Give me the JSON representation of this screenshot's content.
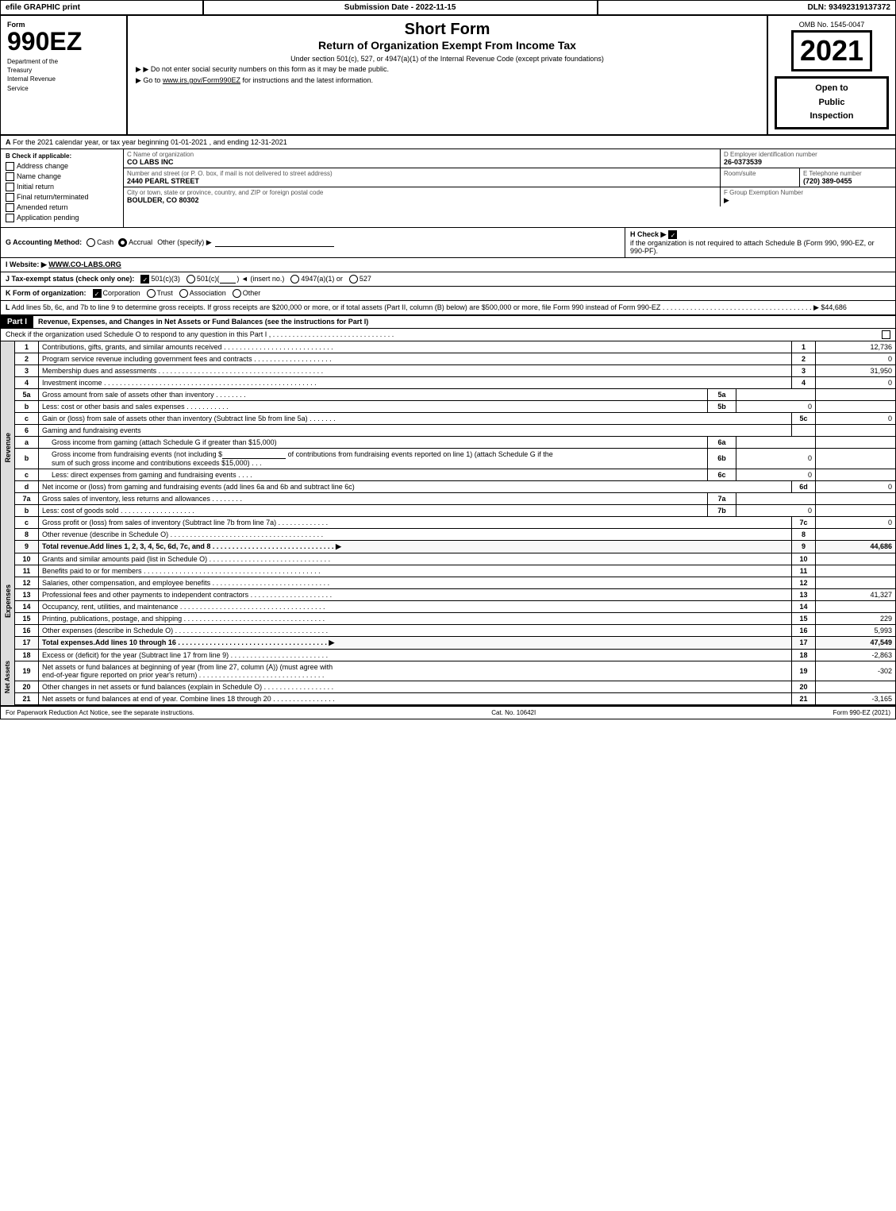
{
  "topbar": {
    "left": "efile GRAPHIC print",
    "mid": "Submission Date - 2022-11-15",
    "right": "DLN: 93492319137372"
  },
  "header": {
    "form_number": "990EZ",
    "dept_line1": "Department of the",
    "dept_line2": "Treasury",
    "dept_line3": "Internal Revenue",
    "dept_line4": "Service",
    "title1": "Short Form",
    "title2": "Return of Organization Exempt From Income Tax",
    "subtitle": "Under section 501(c), 527, or 4947(a)(1) of the Internal Revenue Code (except private foundations)",
    "note1": "▶ Do not enter social security numbers on this form as it may be made public.",
    "note2": "▶ Go to www.irs.gov/Form990EZ for instructions and the latest information.",
    "omb": "OMB No. 1545-0047",
    "year": "2021",
    "open_public": "Open to\nPublic\nInspection"
  },
  "section_a": {
    "label": "A",
    "text": "For the 2021 calendar year, or tax year beginning 01-01-2021 , and ending 12-31-2021"
  },
  "check_applicable": {
    "label": "B Check if applicable:",
    "items": [
      {
        "id": "address_change",
        "label": "Address change",
        "checked": false
      },
      {
        "id": "name_change",
        "label": "Name change",
        "checked": false
      },
      {
        "id": "initial_return",
        "label": "Initial return",
        "checked": false
      },
      {
        "id": "final_return",
        "label": "Final return/terminated",
        "checked": false
      },
      {
        "id": "amended_return",
        "label": "Amended return",
        "checked": false
      },
      {
        "id": "application_pending",
        "label": "Application pending",
        "checked": false
      }
    ]
  },
  "org_info": {
    "c_label": "C Name of organization",
    "c_value": "CO LABS INC",
    "d_label": "D Employer identification number",
    "d_value": "26-0373539",
    "street_label": "Number and street (or P. O. box, if mail is not delivered to street address)",
    "street_value": "2440 PEARL STREET",
    "room_label": "Room/suite",
    "room_value": "",
    "e_label": "E Telephone number",
    "e_value": "(720) 389-0455",
    "city_label": "City or town, state or province, country, and ZIP or foreign postal code",
    "city_value": "BOULDER, CO  80302",
    "f_label": "F Group Exemption Number",
    "f_value": "▶"
  },
  "accounting": {
    "label": "G Accounting Method:",
    "cash_label": "Cash",
    "accrual_label": "Accrual",
    "accrual_checked": true,
    "other_label": "Other (specify) ▶"
  },
  "h_check": {
    "label": "H Check ▶",
    "checked": true,
    "text": "if the organization is not required to attach Schedule B (Form 990, 990-EZ, or 990-PF)."
  },
  "website": {
    "label": "I Website: ▶",
    "value": "WWW.CO-LABS.ORG"
  },
  "tax_status": {
    "label": "J Tax-exempt status (check only one):",
    "options": [
      {
        "id": "501c3",
        "label": "501(c)(3)",
        "checked": true
      },
      {
        "id": "501c",
        "label": "501(c)(",
        "checked": false,
        "note": ") ◄ (insert no.)"
      },
      {
        "id": "4947a1",
        "label": "4947(a)(1) or",
        "checked": false
      },
      {
        "id": "527",
        "label": "527",
        "checked": false
      }
    ]
  },
  "form_org": {
    "label": "K Form of organization:",
    "options": [
      {
        "id": "corp",
        "label": "Corporation",
        "checked": true
      },
      {
        "id": "trust",
        "label": "Trust",
        "checked": false
      },
      {
        "id": "assoc",
        "label": "Association",
        "checked": false
      },
      {
        "id": "other",
        "label": "Other",
        "checked": false
      }
    ]
  },
  "l_text": "L Add lines 5b, 6c, and 7b to line 9 to determine gross receipts. If gross receipts are $200,000 or more, or if total assets (Part II, column (B) below) are $500,000 or more, file Form 990 instead of Form 990-EZ . . . . . . . . . . . . . . . . . . . . . . . . . . . . . . . . . . . . . . ▶ $44,686",
  "part1": {
    "header": "Part I",
    "title": "Revenue, Expenses, and Changes in Net Assets or Fund Balances (see the instructions for Part I)",
    "check_note": "Check if the organization used Schedule O to respond to any question in this Part I , . . . . . . . . . . . . . . . . . . . . . . . . . . . . . . .",
    "rows": [
      {
        "num": "1",
        "desc": "Contributions, gifts, grants, and similar amounts received",
        "dots": true,
        "line_num": "1",
        "value": "12,736",
        "indent": false
      },
      {
        "num": "2",
        "desc": "Program service revenue including government fees and contracts",
        "dots": true,
        "line_num": "2",
        "value": "0",
        "indent": false
      },
      {
        "num": "3",
        "desc": "Membership dues and assessments",
        "dots": true,
        "line_num": "3",
        "value": "31,950",
        "indent": false
      },
      {
        "num": "4",
        "desc": "Investment income",
        "dots": true,
        "line_num": "4",
        "value": "0",
        "indent": false
      },
      {
        "num": "5a",
        "desc": "Gross amount from sale of assets other than inventory",
        "dots": false,
        "box_label": "5a",
        "box_val": "",
        "line_num": "",
        "value": "",
        "indent": false
      },
      {
        "num": "5b",
        "desc": "Less: cost or other basis and sales expenses",
        "dots": false,
        "box_label": "5b",
        "box_val": "0",
        "line_num": "",
        "value": "",
        "indent": false
      },
      {
        "num": "5c",
        "desc": "Gain or (loss) from sale of assets other than inventory (Subtract line 5b from line 5a)",
        "dots": true,
        "line_num": "5c",
        "value": "0",
        "indent": false
      },
      {
        "num": "6",
        "desc": "Gaming and fundraising events",
        "dots": false,
        "line_num": "",
        "value": "",
        "indent": false
      },
      {
        "num": "6a",
        "desc": "Gross income from gaming (attach Schedule G if greater than $15,000)",
        "dots": false,
        "box_label": "6a",
        "box_val": "",
        "line_num": "",
        "value": "",
        "indent": true
      },
      {
        "num": "6b_text",
        "desc": "Gross income from fundraising events (not including $_____ of contributions from fundraising events reported on line 1) (attach Schedule G if the sum of such gross income and contributions exceeds $15,000)",
        "dots": false,
        "box_label": "6b",
        "box_val": "0",
        "line_num": "",
        "value": "",
        "indent": true
      },
      {
        "num": "6c",
        "desc": "Less: direct expenses from gaming and fundraising events",
        "dots": false,
        "box_label": "6c",
        "box_val": "0",
        "line_num": "",
        "value": "",
        "indent": true
      },
      {
        "num": "6d",
        "desc": "Net income or (loss) from gaming and fundraising events (add lines 6a and 6b and subtract line 6c)",
        "dots": false,
        "line_num": "6d",
        "value": "0",
        "indent": false
      },
      {
        "num": "7a",
        "desc": "Gross sales of inventory, less returns and allowances",
        "dots": true,
        "box_label": "7a",
        "box_val": "",
        "line_num": "",
        "value": "",
        "indent": false
      },
      {
        "num": "7b",
        "desc": "Less: cost of goods sold",
        "dots": true,
        "box_label": "7b",
        "box_val": "0",
        "line_num": "",
        "value": "",
        "indent": false
      },
      {
        "num": "7c",
        "desc": "Gross profit or (loss) from sales of inventory (Subtract line 7b from line 7a)",
        "dots": true,
        "line_num": "7c",
        "value": "0",
        "indent": false
      },
      {
        "num": "8",
        "desc": "Other revenue (describe in Schedule O)",
        "dots": true,
        "line_num": "8",
        "value": "",
        "indent": false
      },
      {
        "num": "9",
        "desc": "Total revenue. Add lines 1, 2, 3, 4, 5c, 6d, 7c, and 8",
        "dots": true,
        "arrow": true,
        "line_num": "9",
        "value": "44,686",
        "indent": false,
        "bold": true
      }
    ]
  },
  "expenses": {
    "rows": [
      {
        "num": "10",
        "desc": "Grants and similar amounts paid (list in Schedule O)",
        "dots": true,
        "line_num": "10",
        "value": ""
      },
      {
        "num": "11",
        "desc": "Benefits paid to or for members",
        "dots": true,
        "line_num": "11",
        "value": ""
      },
      {
        "num": "12",
        "desc": "Salaries, other compensation, and employee benefits",
        "dots": true,
        "line_num": "12",
        "value": ""
      },
      {
        "num": "13",
        "desc": "Professional fees and other payments to independent contractors",
        "dots": true,
        "line_num": "13",
        "value": "41,327"
      },
      {
        "num": "14",
        "desc": "Occupancy, rent, utilities, and maintenance",
        "dots": true,
        "line_num": "14",
        "value": ""
      },
      {
        "num": "15",
        "desc": "Printing, publications, postage, and shipping",
        "dots": true,
        "line_num": "15",
        "value": "229"
      },
      {
        "num": "16",
        "desc": "Other expenses (describe in Schedule O)",
        "dots": true,
        "line_num": "16",
        "value": "5,993"
      },
      {
        "num": "17",
        "desc": "Total expenses. Add lines 10 through 16",
        "dots": true,
        "arrow": true,
        "line_num": "17",
        "value": "47,549",
        "bold": true
      }
    ]
  },
  "net_assets": {
    "rows": [
      {
        "num": "18",
        "desc": "Excess or (deficit) for the year (Subtract line 17 from line 9)",
        "dots": true,
        "line_num": "18",
        "value": "-2,863"
      },
      {
        "num": "19",
        "desc": "Net assets or fund balances at beginning of year (from line 27, column (A)) (must agree with end-of-year figure reported on prior year's return)",
        "dots": true,
        "line_num": "19",
        "value": "-302"
      },
      {
        "num": "20",
        "desc": "Other changes in net assets or fund balances (explain in Schedule O)",
        "dots": true,
        "line_num": "20",
        "value": ""
      },
      {
        "num": "21",
        "desc": "Net assets or fund balances at end of year. Combine lines 18 through 20",
        "dots": true,
        "line_num": "21",
        "value": "-3,165"
      }
    ]
  },
  "footer": {
    "left": "For Paperwork Reduction Act Notice, see the separate instructions.",
    "mid": "Cat. No. 10642I",
    "right": "Form 990-EZ (2021)"
  }
}
